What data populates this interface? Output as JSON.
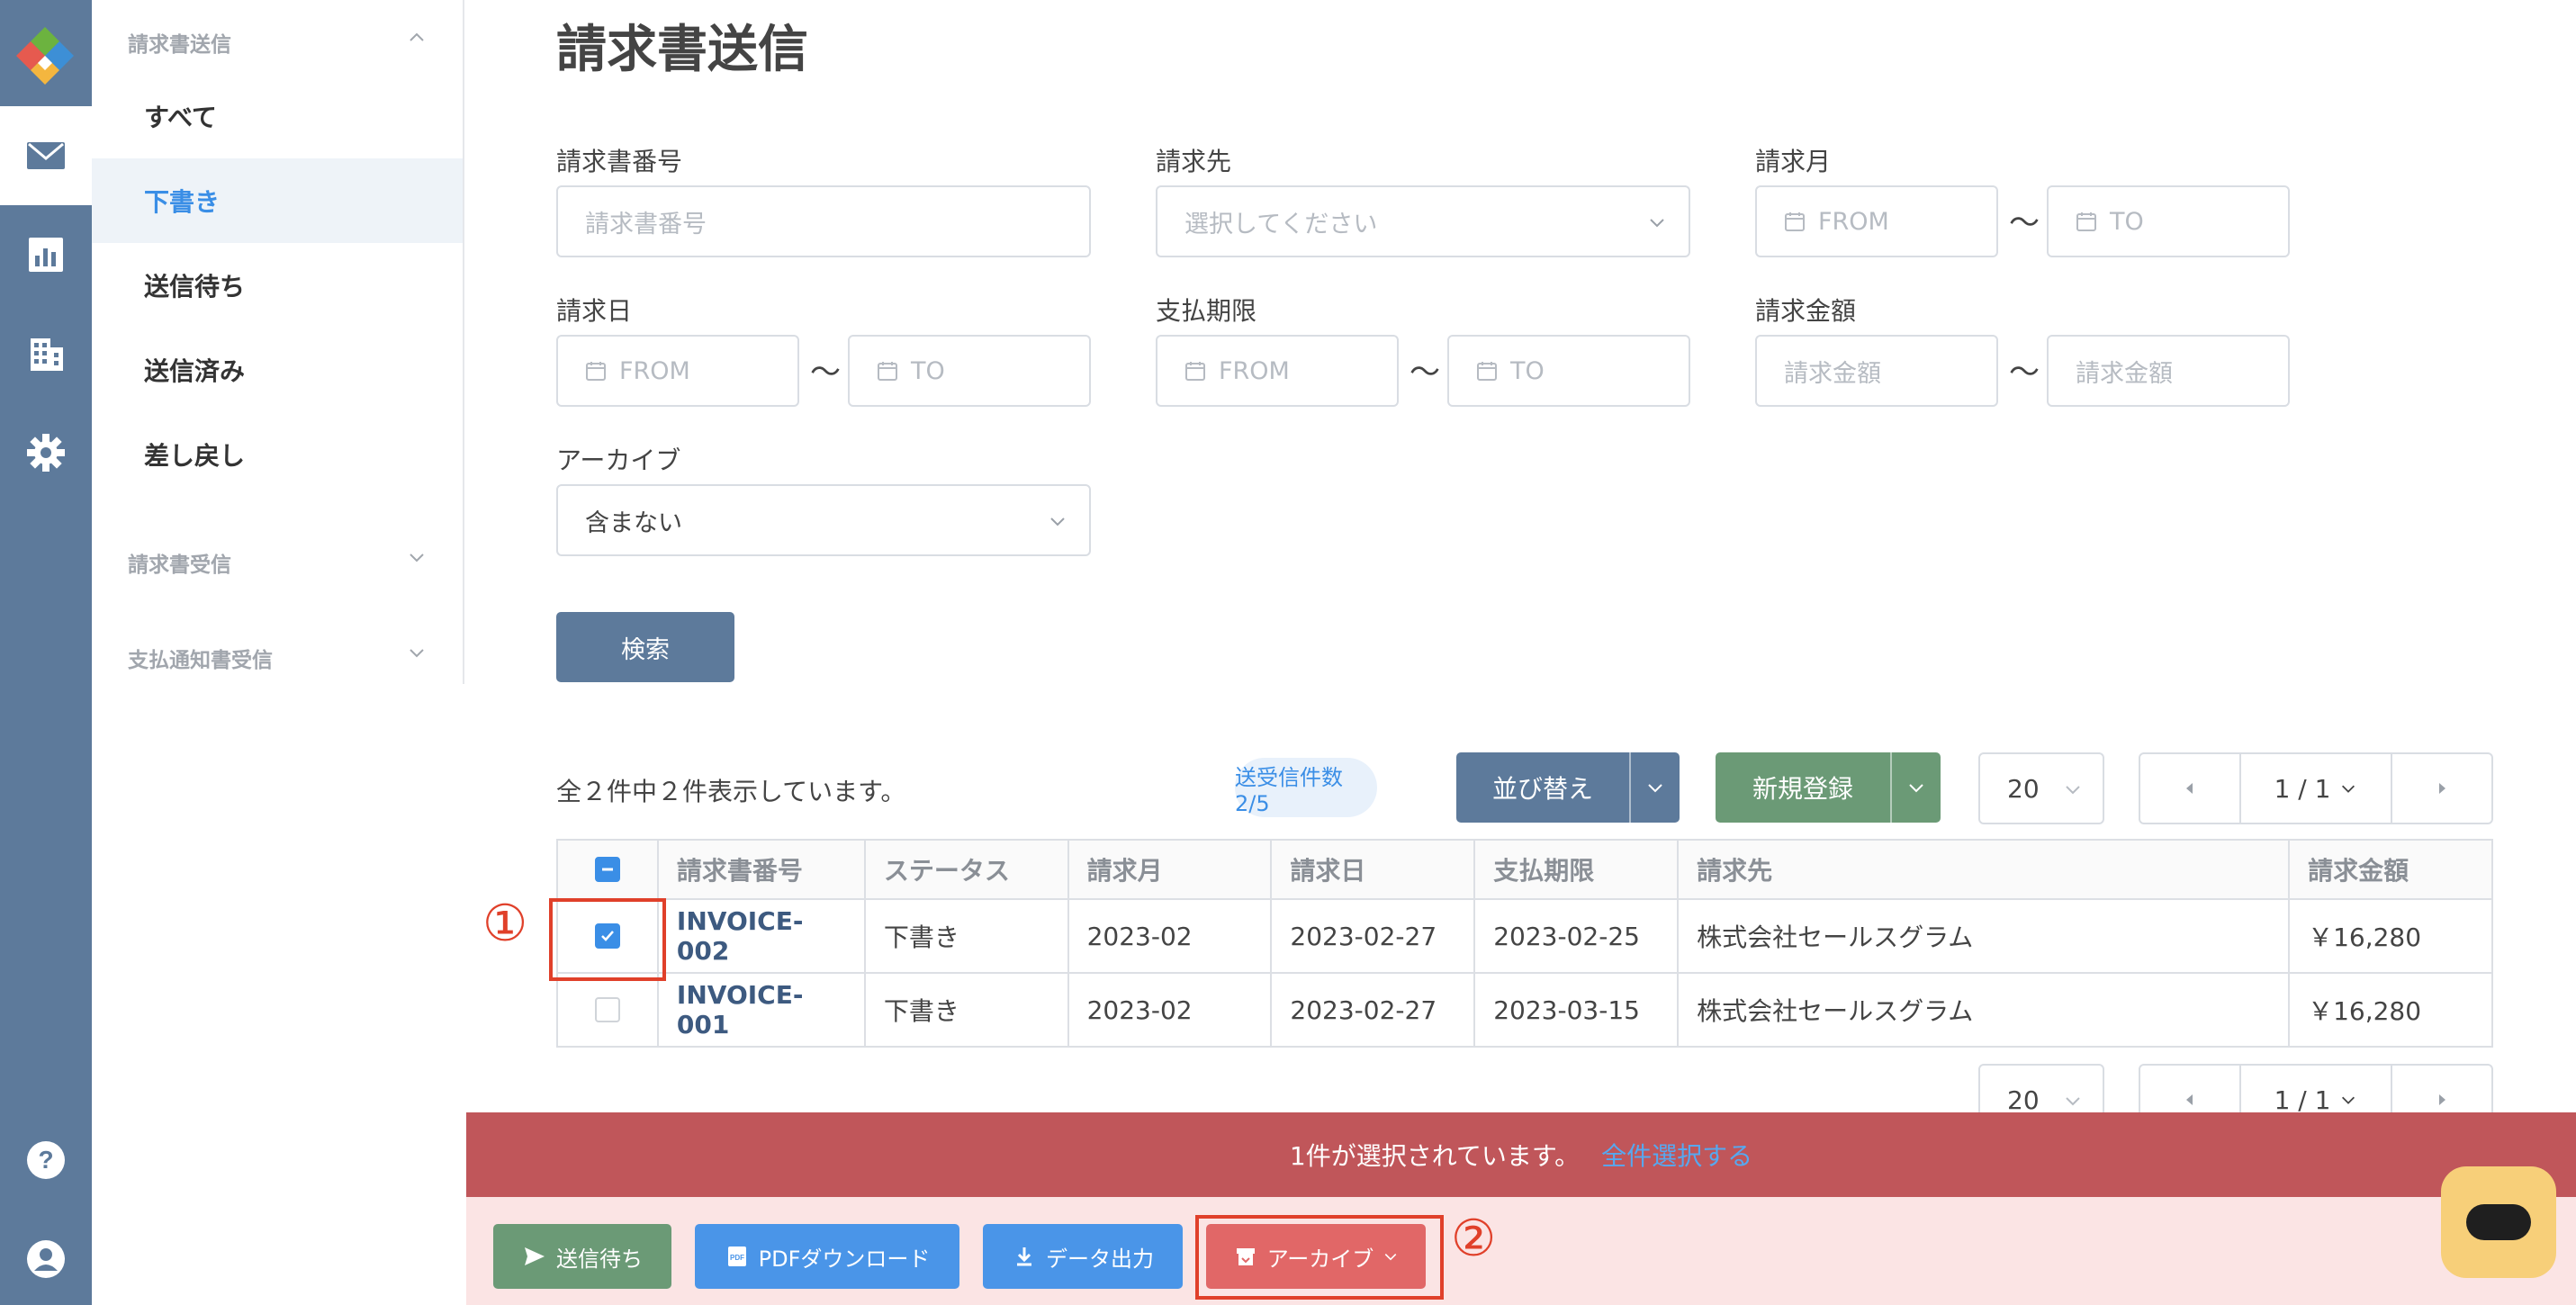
{
  "sidebar": {
    "sections": [
      {
        "label": "請求書送信"
      },
      {
        "label": "請求書受信"
      },
      {
        "label": "支払通知書受信"
      }
    ],
    "items": [
      {
        "label": "すべて"
      },
      {
        "label": "下書き"
      },
      {
        "label": "送信待ち"
      },
      {
        "label": "送信済み"
      },
      {
        "label": "差し戻し"
      }
    ]
  },
  "page": {
    "title": "請求書送信"
  },
  "filters": {
    "invoice_no": {
      "label": "請求書番号",
      "placeholder": "請求書番号"
    },
    "client": {
      "label": "請求先",
      "placeholder": "選択してください"
    },
    "month": {
      "label": "請求月",
      "from": "FROM",
      "to": "TO"
    },
    "invoice_date": {
      "label": "請求日",
      "from": "FROM",
      "to": "TO"
    },
    "due_date": {
      "label": "支払期限",
      "from": "FROM",
      "to": "TO"
    },
    "amount": {
      "label": "請求金額",
      "from": "請求金額",
      "to": "請求金額"
    },
    "archive": {
      "label": "アーカイブ",
      "value": "含まない"
    },
    "tilde": "〜",
    "search_button": "検索"
  },
  "toolbar": {
    "count_text": "全２件中２件表示しています。",
    "pill": "送受信件数 2/5",
    "sort_button": "並び替え",
    "new_button": "新規登録",
    "page_size": "20",
    "page_indicator": "1 / 1"
  },
  "table": {
    "columns": [
      "請求書番号",
      "ステータス",
      "請求月",
      "請求日",
      "支払期限",
      "請求先",
      "請求金額"
    ],
    "rows": [
      {
        "checked": true,
        "cells": [
          "INVOICE-002",
          "下書き",
          "2023-02",
          "2023-02-27",
          "2023-02-25",
          "株式会社セールスグラム",
          "￥16,280"
        ]
      },
      {
        "checked": false,
        "cells": [
          "INVOICE-001",
          "下書き",
          "2023-02",
          "2023-02-27",
          "2023-03-15",
          "株式会社セールスグラム",
          "￥16,280"
        ]
      }
    ]
  },
  "bottom_pager": {
    "page_size": "20",
    "page_indicator": "1 / 1"
  },
  "selection_bar": {
    "text": "1件が選択されています。",
    "link": "全件選択する"
  },
  "actions": {
    "send_wait": "送信待ち",
    "pdf": "PDFダウンロード",
    "export": "データ出力",
    "archive": "アーカイブ"
  },
  "annotations": {
    "one": "①",
    "two": "②"
  },
  "colors": {
    "rail": "#5d7a9b",
    "primary_blue": "#3a8ee6",
    "green": "#6b9a76",
    "red_bar": "#c0565a",
    "archive_button": "#e16767"
  }
}
